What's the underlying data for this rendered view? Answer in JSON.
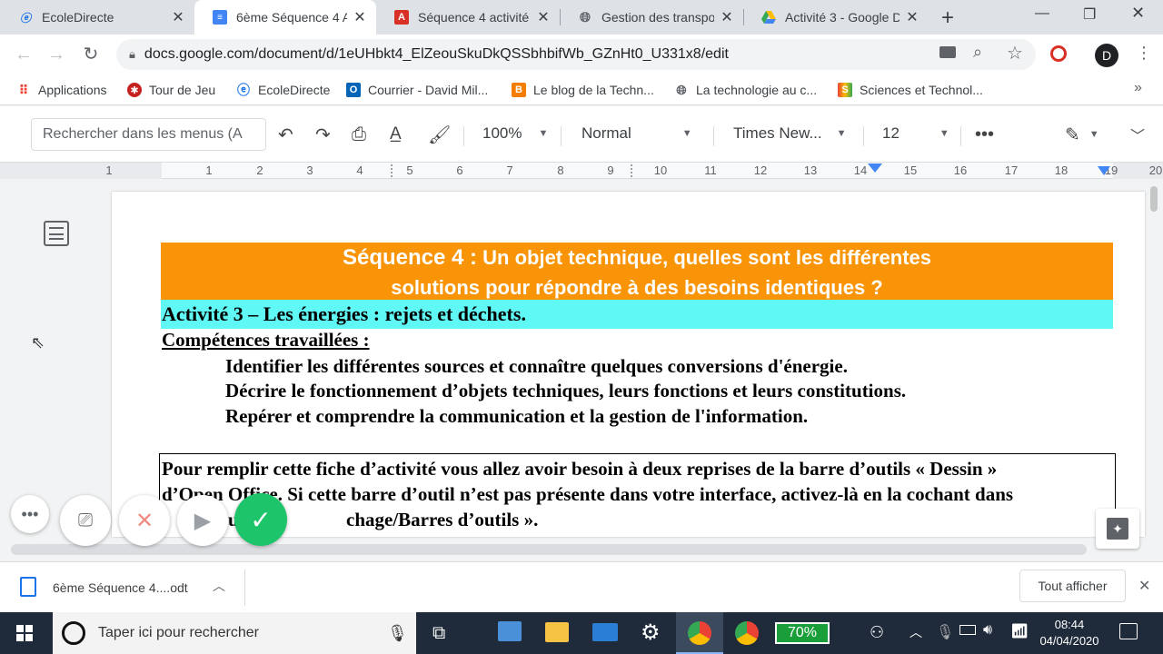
{
  "tabs": [
    {
      "title": "EcoleDirecte",
      "icon": "ecoledirecte-icon",
      "active": false
    },
    {
      "title": "6ème Séquence 4 Ac",
      "icon": "docs-icon",
      "active": true
    },
    {
      "title": "Séquence 4 activité :",
      "icon": "pdf-icon",
      "active": false
    },
    {
      "title": "Gestion des transpo",
      "icon": "globe-icon",
      "active": false
    },
    {
      "title": "Activité 3 - Google D",
      "icon": "drive-icon",
      "active": false
    }
  ],
  "address": {
    "url": "docs.google.com/document/d/1eUHbkt4_ElZeouSkuDkQSSbhbifWb_GZnHt0_U331x8/edit"
  },
  "profile": {
    "initial": "D"
  },
  "bookmarks": [
    {
      "label": "Applications",
      "icon": "apps-grid-icon"
    },
    {
      "label": "Tour de Jeu",
      "icon": "tour-de-jeu-icon"
    },
    {
      "label": "EcoleDirecte",
      "icon": "ecoledirecte-icon"
    },
    {
      "label": "Courrier - David Mil...",
      "icon": "outlook-icon"
    },
    {
      "label": "Le blog de la Techn...",
      "icon": "blogger-icon"
    },
    {
      "label": "La technologie au c...",
      "icon": "globe-icon"
    },
    {
      "label": "Sciences et Technol...",
      "icon": "sciences-icon"
    }
  ],
  "docs_toolbar": {
    "menu_search_placeholder": "Rechercher dans les menus (A",
    "zoom": "100%",
    "style": "Normal",
    "font": "Times New...",
    "font_size": "12"
  },
  "ruler": {
    "labels": [
      "1",
      "1",
      "2",
      "3",
      "4",
      "5",
      "6",
      "7",
      "8",
      "9",
      "10",
      "11",
      "12",
      "13",
      "14",
      "15",
      "16",
      "17",
      "18",
      "19",
      "20"
    ]
  },
  "document": {
    "banner_line1_prefix": "Séquence 4 :",
    "banner_line1_rest": " Un objet technique, quelles sont les différentes",
    "banner_line2": "solutions pour répondre à des besoins identiques ?",
    "activity_title": "Activité 3 – Les énergies : rejets et déchets.",
    "skills_heading": "Compétences travaillées :",
    "skills": [
      "Identifier les différentes sources et connaître quelques conversions d'énergie.",
      "Décrire le fonctionnement d’objets techniques, leurs fonctions et leurs constitutions.",
      "Repérer et comprendre la communication et la gestion de l'information."
    ],
    "box_lines": [
      "Pour remplir cette fiche d’activité vous allez avoir besoin à deux reprises de la barre d’outils « Dessin »",
      "d’Open Office. Si cette barre d’outil n’est pas présente dans votre interface, activez-là en la cochant dans",
      "chage/Barres d’outils »."
    ],
    "box_line3_prefix": "e",
    "box_line3_mid": "u"
  },
  "download": {
    "filename": "6ème Séquence 4....odt",
    "show_all": "Tout afficher"
  },
  "taskbar": {
    "search_placeholder": "Taper ici pour rechercher",
    "battery": "70%",
    "time": "08:44",
    "date": "04/04/2020"
  }
}
